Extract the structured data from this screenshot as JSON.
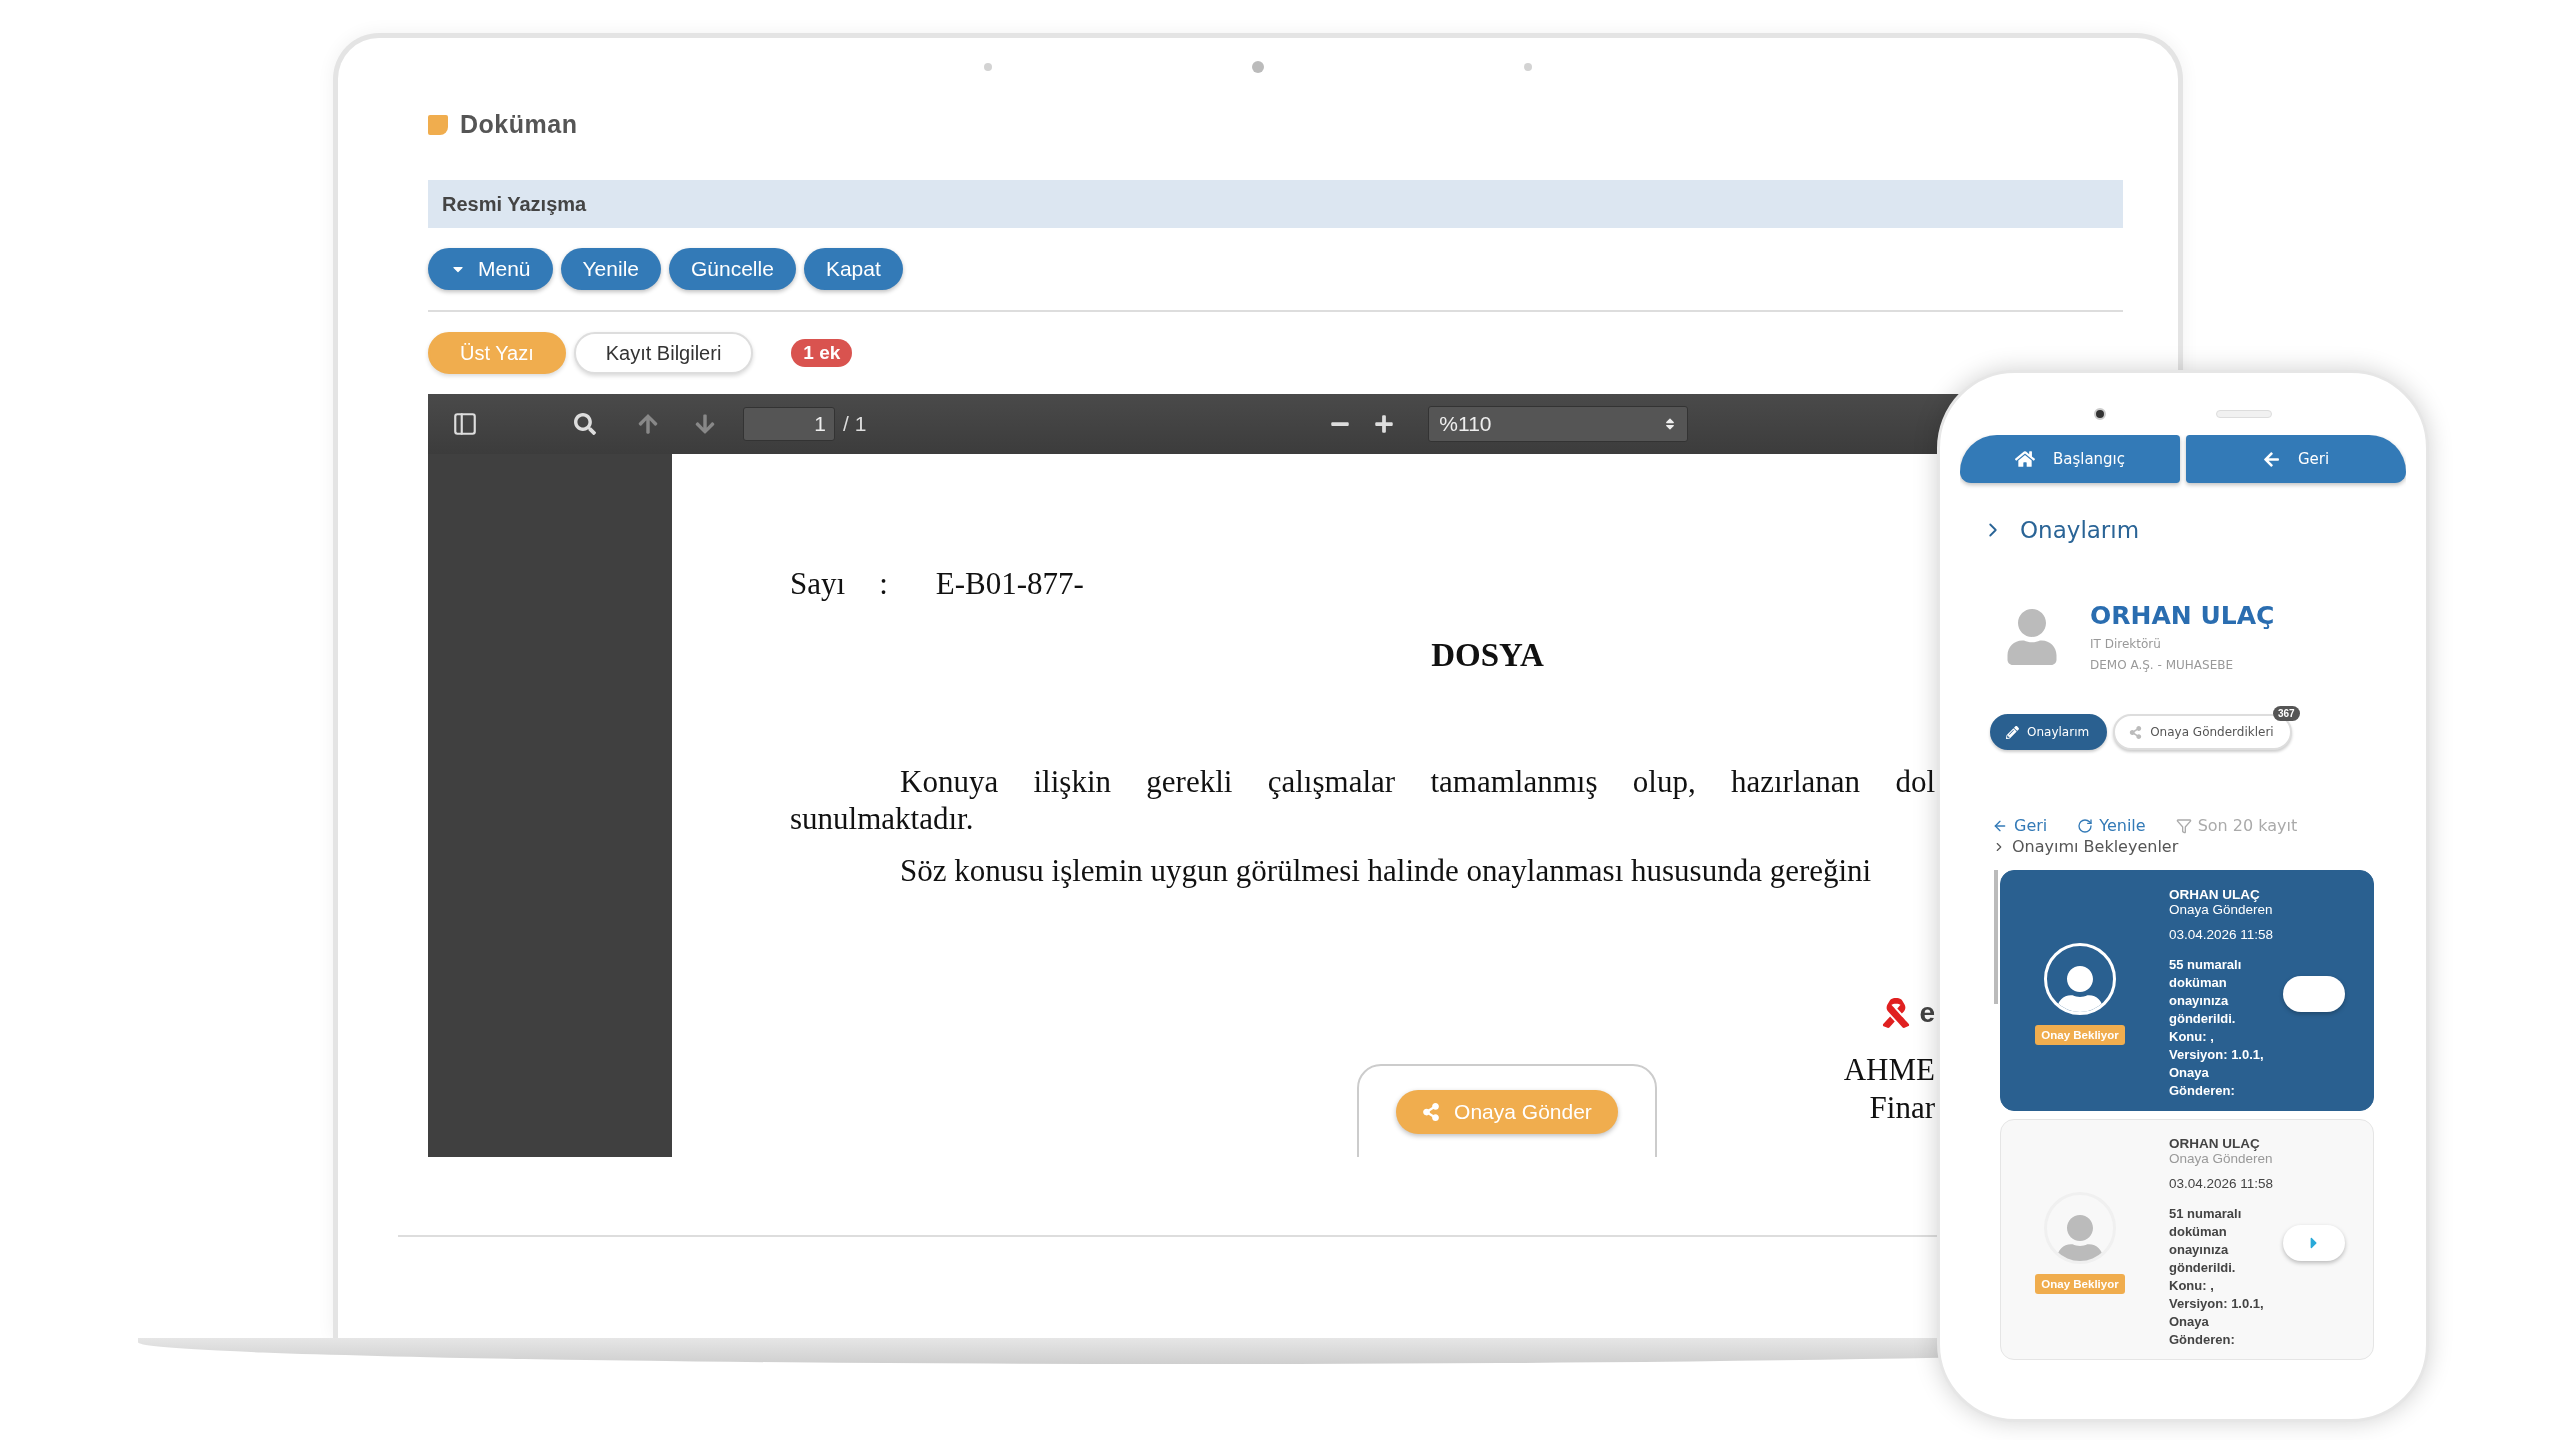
{
  "laptop": {
    "page_title": "Doküman",
    "section_title": "Resmi Yazışma",
    "buttons": [
      {
        "label": "Menü",
        "kind": "menu"
      },
      {
        "label": "Yenile",
        "kind": "plain"
      },
      {
        "label": "Güncelle",
        "kind": "plain"
      },
      {
        "label": "Kapat",
        "kind": "plain"
      }
    ],
    "tabs": [
      {
        "label": "Üst Yazı",
        "selected": true
      },
      {
        "label": "Kayıt Bilgileri",
        "selected": false
      }
    ],
    "attachment_badge": "1 ek",
    "viewer": {
      "page_number": "1",
      "page_count": "/ 1",
      "zoom": "%110",
      "document": {
        "number_label": "Sayı",
        "colon": ":",
        "number": "E-B01-877-",
        "heading": "DOSYA",
        "paragraphs": [
          {
            "text": "Konuya ilişkin gerekli çalışmalar tamamlanmış olup, hazırlanan dol",
            "kind": "justified_indent"
          },
          {
            "text": "sunulmaktadır.",
            "kind": "plain"
          },
          {
            "text": "Söz konusu işlemin uygun görülmesi halinde onaylanması hususunda gereğini",
            "kind": "indent"
          }
        ],
        "logo_letter": "e",
        "signature": [
          "AHME",
          "Finar"
        ]
      }
    },
    "send_button": "Onaya Gönder"
  },
  "phone": {
    "nav": [
      {
        "label": "Başlangıç",
        "kind": "home"
      },
      {
        "label": "Geri",
        "kind": "back"
      }
    ],
    "section_title": "Onaylarım",
    "profile": {
      "name": "ORHAN ULAÇ",
      "title": "IT Direktörü",
      "company": "DEMO A.Ş. - MUHASEBE"
    },
    "filter_buttons": [
      {
        "label": "Onaylarım",
        "selected": true
      },
      {
        "label": "Onaya Gönderdikleri",
        "selected": false,
        "badge": "367"
      }
    ],
    "links": [
      {
        "label": "Geri",
        "kind": "back"
      },
      {
        "label": "Yenile",
        "kind": "refresh"
      },
      {
        "label": "Son 20 kayıt",
        "kind": "filter"
      }
    ],
    "list_title": "Onayımı Bekleyenler",
    "items": [
      {
        "name": "ORHAN ULAÇ",
        "role": "Onaya Gönderen",
        "date": "03.04.2026 11:58",
        "message": "55 numaralı doküman onayınıza gönderildi. Konu: , Versiyon: 1.0.1, Onaya Gönderen:",
        "status": "Onay Bekliyor",
        "selected": true
      },
      {
        "name": "ORHAN ULAÇ",
        "role": "Onaya Gönderen",
        "date": "03.04.2026 11:58",
        "message": "51 numaralı doküman onayınıza gönderildi. Konu: , Versiyon: 1.0.1, Onaya Gönderen:",
        "status": "Onay Bekliyor",
        "selected": false
      }
    ]
  }
}
